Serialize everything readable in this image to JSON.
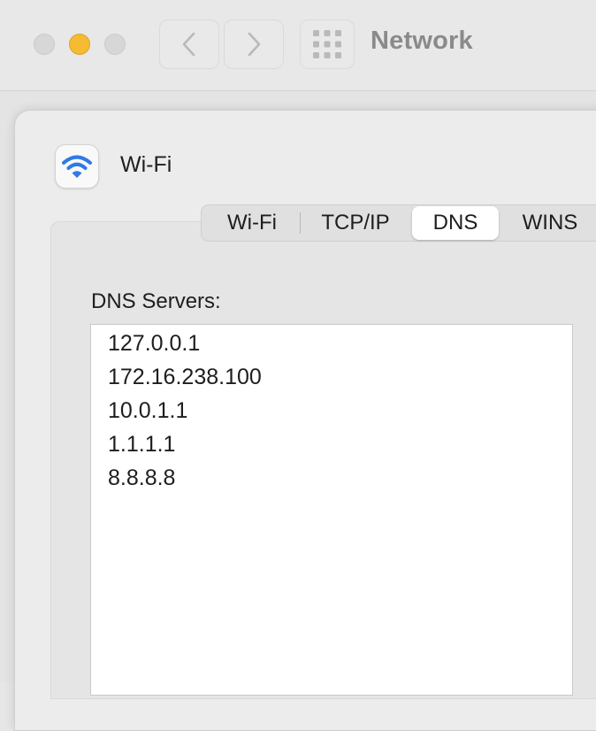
{
  "window": {
    "title": "Network"
  },
  "service": {
    "name": "Wi-Fi",
    "icon": "wifi-icon"
  },
  "tabs": [
    {
      "label": "Wi-Fi"
    },
    {
      "label": "TCP/IP"
    },
    {
      "label": "DNS",
      "selected": true
    },
    {
      "label": "WINS"
    }
  ],
  "dns": {
    "label": "DNS Servers:",
    "servers": [
      "127.0.0.1",
      "172.16.238.100",
      "10.0.1.1",
      "1.1.1.1",
      "8.8.8.8"
    ]
  },
  "colors": {
    "accent": "#2f7ae5",
    "minimize": "#f5bb33"
  }
}
